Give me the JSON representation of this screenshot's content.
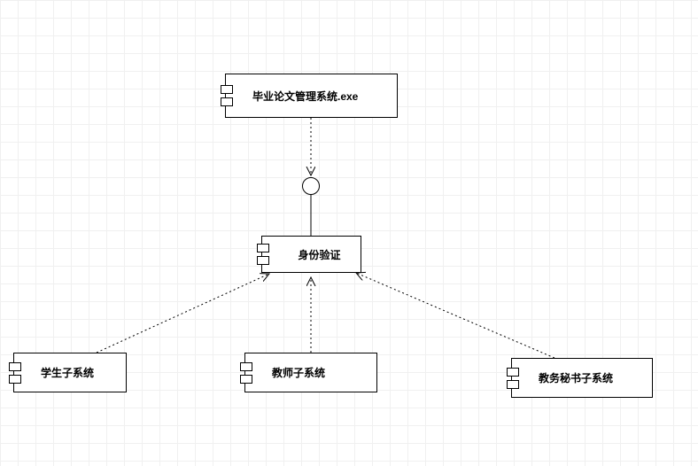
{
  "diagram": {
    "type": "UML Component Diagram",
    "components": {
      "main": {
        "label": "毕业论文管理系统.exe"
      },
      "auth": {
        "label": "身份验证"
      },
      "student": {
        "label": "学生子系统"
      },
      "teacher": {
        "label": "教师子系统"
      },
      "secretary": {
        "label": "教务秘书子系统"
      }
    }
  }
}
